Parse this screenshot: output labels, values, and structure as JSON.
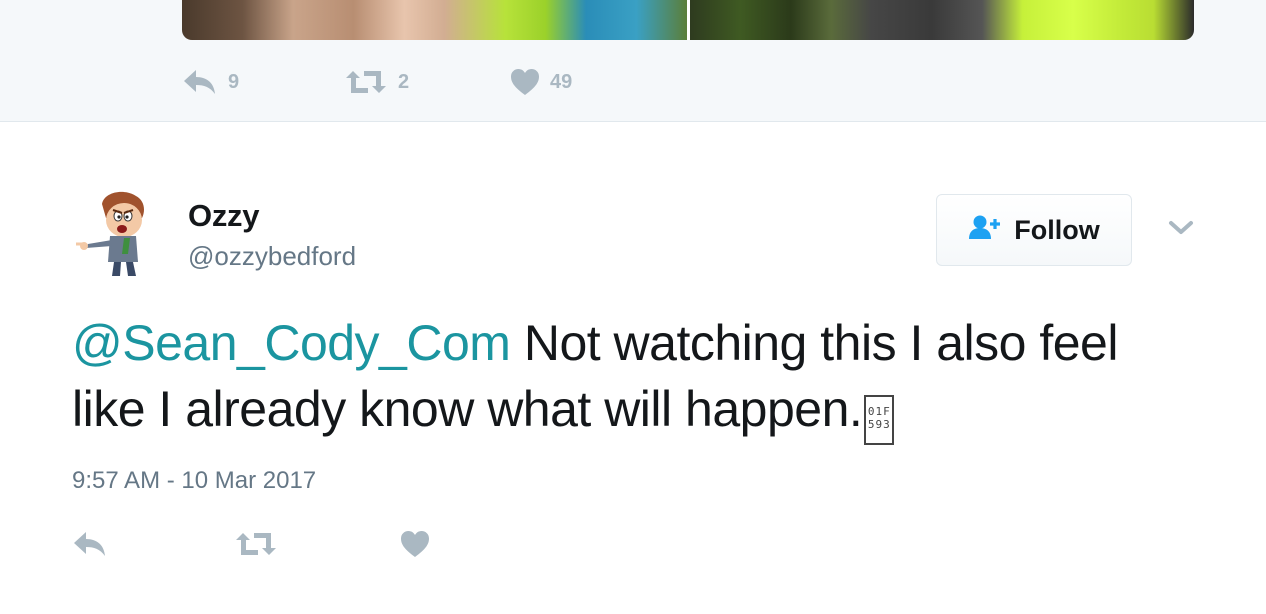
{
  "parent_tweet": {
    "reply_count": "9",
    "retweet_count": "2",
    "like_count": "49"
  },
  "tweet": {
    "display_name": "Ozzy",
    "handle": "@ozzybedford",
    "follow_label": "Follow",
    "mention": "@Sean_Cody_Com",
    "text": " Not watching this I also feel like I already know what will happen.",
    "glyph_top": "01F",
    "glyph_bottom": "593",
    "timestamp": "9:57 AM - 10 Mar 2017"
  },
  "icons": {
    "reply": "reply-icon",
    "retweet": "retweet-icon",
    "like": "heart-icon",
    "follow": "add-user-icon",
    "more": "chevron-down-icon"
  },
  "colors": {
    "mention": "#1b95a0",
    "icon_gray": "#aab8c2",
    "secondary_text": "#657786",
    "follow_icon": "#1da1f2"
  }
}
